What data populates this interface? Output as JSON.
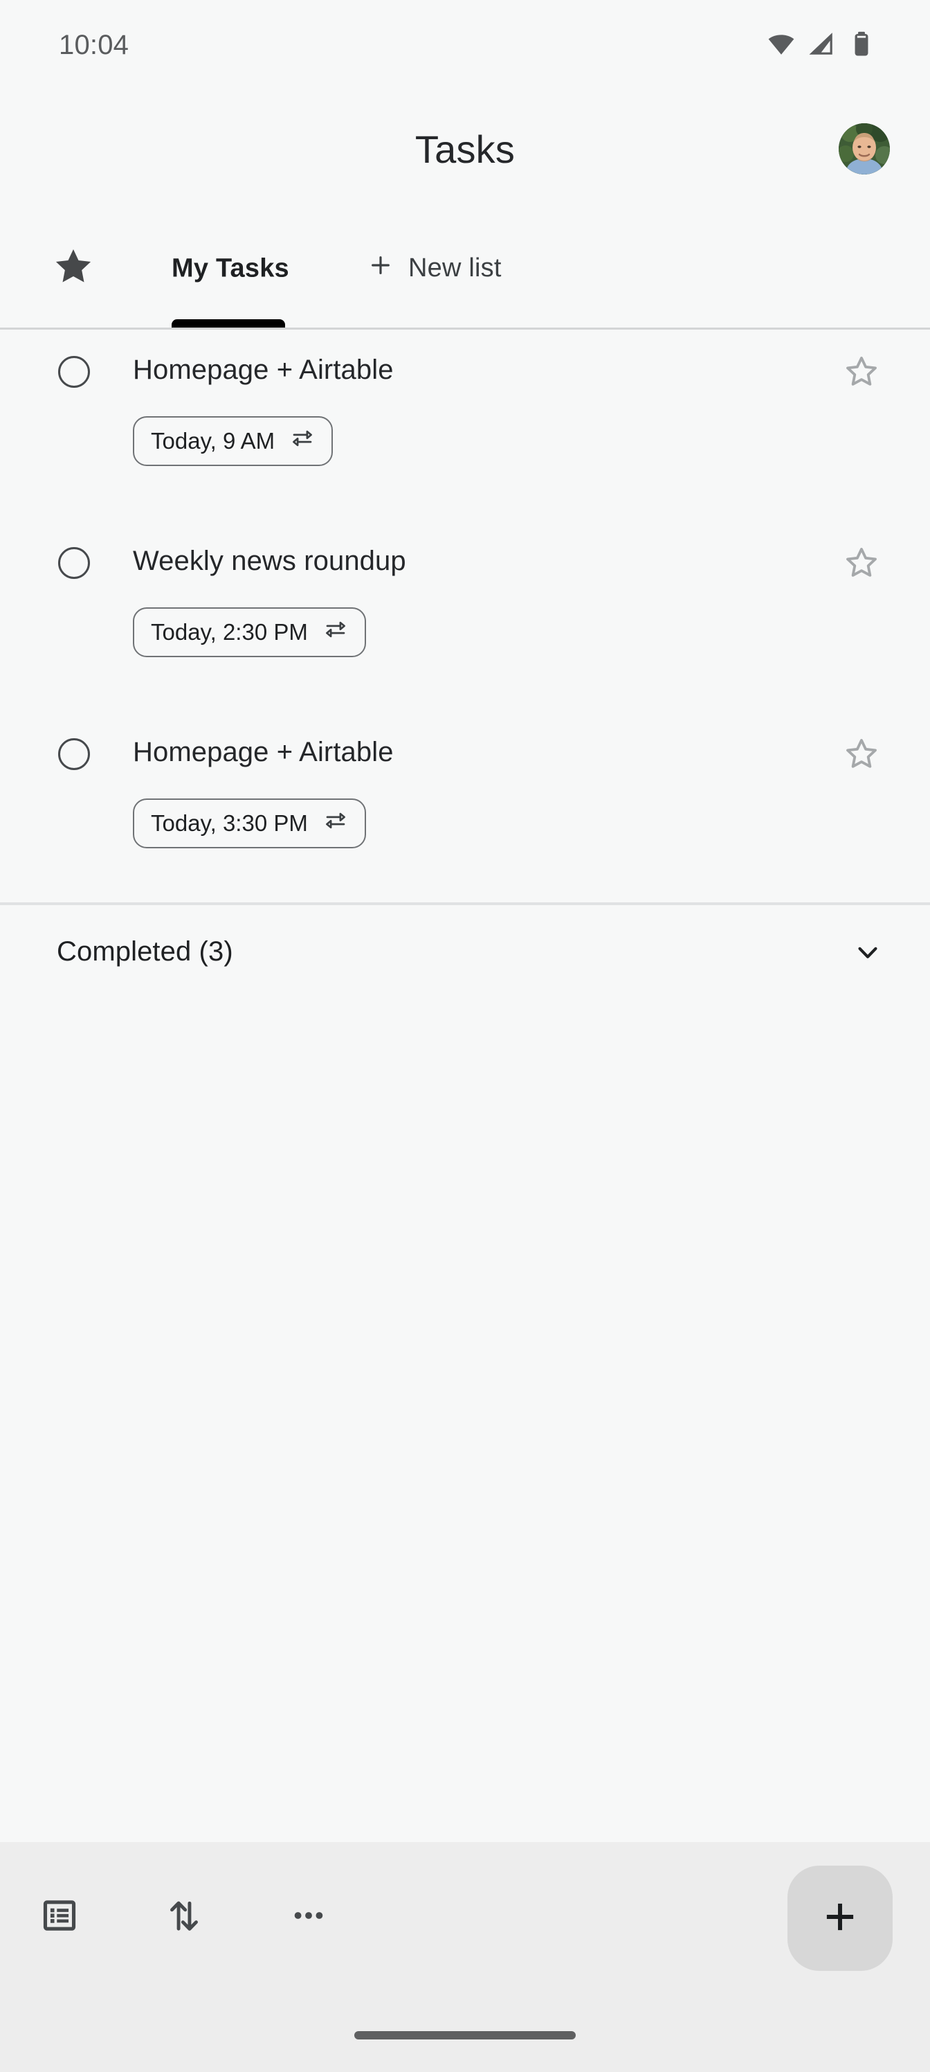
{
  "status_bar": {
    "time": "10:04",
    "icons": [
      "wifi-icon",
      "cellular-signal-icon",
      "battery-icon"
    ]
  },
  "header": {
    "title": "Tasks",
    "avatar_name": "account-avatar"
  },
  "tabs": {
    "star_tab_icon": "star-filled-icon",
    "items": [
      {
        "label": "My Tasks",
        "active": true
      },
      {
        "label": "New list",
        "active": false,
        "icon": "plus-icon"
      }
    ]
  },
  "tasks": [
    {
      "title": "Homepage + Airtable",
      "due": "Today, 9 AM",
      "repeat_icon": "repeat-icon",
      "checkbox_icon": "circle-unchecked-icon",
      "star_icon": "star-outline-icon",
      "starred": false
    },
    {
      "title": "Weekly news roundup",
      "due": "Today, 2:30 PM",
      "repeat_icon": "repeat-icon",
      "checkbox_icon": "circle-unchecked-icon",
      "star_icon": "star-outline-icon",
      "starred": false
    },
    {
      "title": "Homepage + Airtable",
      "due": "Today, 3:30 PM",
      "repeat_icon": "repeat-icon",
      "checkbox_icon": "circle-unchecked-icon",
      "star_icon": "star-outline-icon",
      "starred": false
    }
  ],
  "completed": {
    "label": "Completed (3)",
    "count": 3,
    "expanded": false,
    "chevron_icon": "chevron-down-icon"
  },
  "bottom_bar": {
    "actions": [
      {
        "name": "switch-list-button",
        "icon": "list-icon"
      },
      {
        "name": "sort-button",
        "icon": "sort-arrows-icon"
      },
      {
        "name": "more-options-button",
        "icon": "more-horizontal-icon"
      }
    ],
    "fab": {
      "name": "add-task-button",
      "icon": "plus-icon"
    }
  },
  "colors": {
    "background": "#f7f8f8",
    "bottom_bar": "#ededed",
    "text_primary": "#25272a",
    "text_secondary": "#5a5c5e",
    "divider": "#e0e2e3",
    "tab_indicator": "#000000",
    "fab_background": "#d7d7d7",
    "home_indicator": "#5f6061"
  }
}
